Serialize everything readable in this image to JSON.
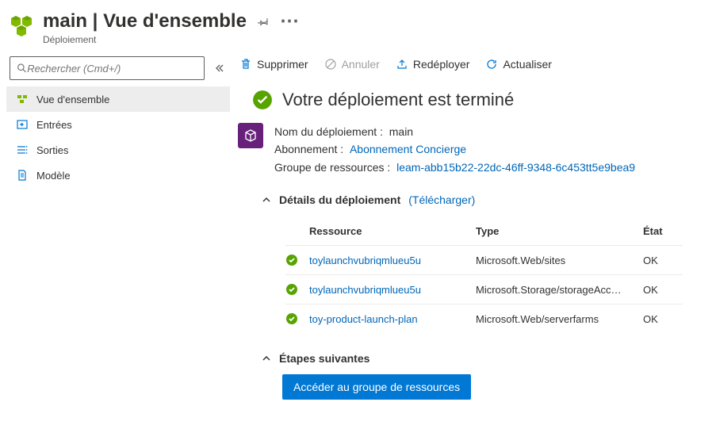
{
  "header": {
    "title": "main | Vue d'ensemble",
    "subtitle": "Déploiement"
  },
  "search": {
    "placeholder": "Rechercher (Cmd+/)"
  },
  "nav": {
    "overview": "Vue d'ensemble",
    "inputs": "Entrées",
    "outputs": "Sorties",
    "template": "Modèle"
  },
  "toolbar": {
    "delete": "Supprimer",
    "cancel": "Annuler",
    "redeploy": "Redéployer",
    "refresh": "Actualiser"
  },
  "status": {
    "title": "Votre déploiement est terminé"
  },
  "meta": {
    "deployment_label": "Nom du déploiement :",
    "deployment_value": "main",
    "subscription_label": "Abonnement :",
    "subscription_value": "Abonnement Concierge",
    "rg_label": "Groupe de ressources :",
    "rg_value": "leam-abb15b22-22dc-46ff-9348-6c453tt5e9bea9"
  },
  "details": {
    "title": "Détails du déploiement",
    "download": "(Télécharger)",
    "columns": {
      "resource": "Ressource",
      "type": "Type",
      "state": "État"
    },
    "rows": [
      {
        "resource": "toylaunchvubriqmlueu5u",
        "type": "Microsoft.Web/sites",
        "state": "OK"
      },
      {
        "resource": "toylaunchvubriqmlueu5u",
        "type": "Microsoft.Storage/storageAcc…",
        "state": "OK"
      },
      {
        "resource": "toy-product-launch-plan",
        "type": "Microsoft.Web/serverfarms",
        "state": "OK"
      }
    ]
  },
  "next": {
    "title": "Étapes suivantes",
    "button": "Accéder au groupe de ressources"
  }
}
